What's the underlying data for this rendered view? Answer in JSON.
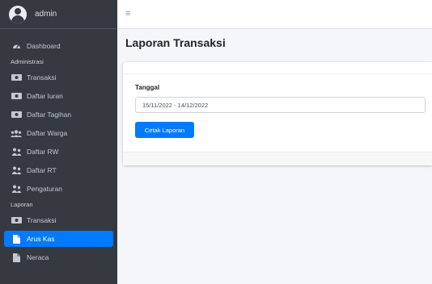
{
  "brand": {
    "user": "admin"
  },
  "sidebar": {
    "items_top": [
      {
        "label": "Dashboard",
        "icon": "tachometer-icon"
      }
    ],
    "section_admin": "Administrasi",
    "items_admin": [
      {
        "label": "Transaksi",
        "icon": "money-bill-icon"
      },
      {
        "label": "Daftar Iuran",
        "icon": "money-bill-icon"
      },
      {
        "label": "Daftar Tagihan",
        "icon": "money-bill-icon"
      },
      {
        "label": "Daftar Warga",
        "icon": "users-icon"
      },
      {
        "label": "Daftar RW",
        "icon": "people-group-icon"
      },
      {
        "label": "Daftar RT",
        "icon": "people-group-icon"
      },
      {
        "label": "Pengaturan",
        "icon": "people-group-icon"
      }
    ],
    "section_report": "Laporan",
    "items_report": [
      {
        "label": "Transaksi",
        "icon": "money-bill-icon"
      },
      {
        "label": "Arus Kas",
        "icon": "file-icon",
        "active": true
      },
      {
        "label": "Neraca",
        "icon": "file-icon"
      }
    ]
  },
  "topbar": {
    "menu_icon": "≡"
  },
  "page": {
    "title": "Laporan Transaksi",
    "form": {
      "date_label": "Tanggal",
      "date_value": "15/11/2022 - 14/12/2022",
      "submit_label": "Cetak Laporan"
    }
  },
  "colors": {
    "sidebar_bg": "#343a40",
    "accent": "#007bff",
    "content_bg": "#f4f6f9"
  }
}
